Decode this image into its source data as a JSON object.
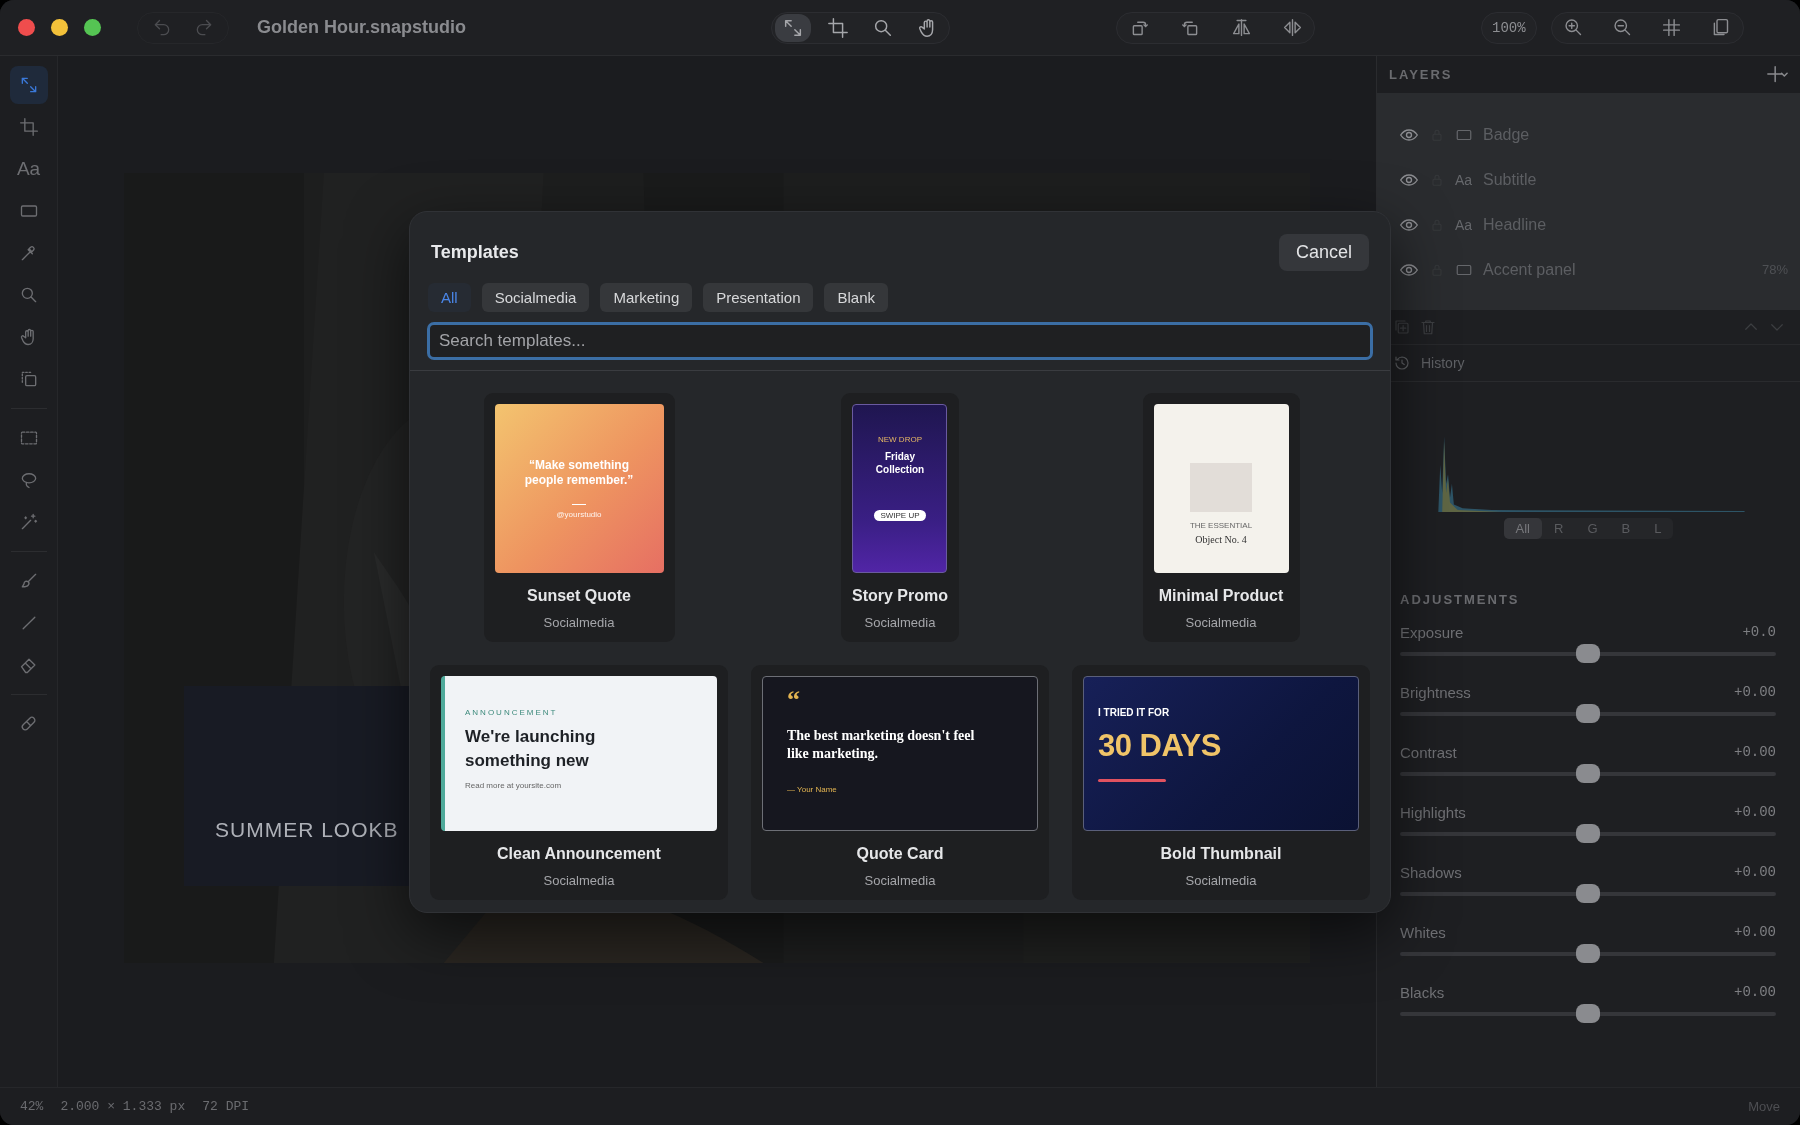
{
  "window": {
    "title": "Golden Hour.snapstudio"
  },
  "toolbar": {
    "center_tools": [
      {
        "selected": true
      },
      {
        "selected": false
      },
      {
        "selected": false
      },
      {
        "selected": false
      }
    ],
    "zoom": "100%"
  },
  "tools": {
    "groups": [
      [
        {
          "selected": true
        },
        {
          "selected": false
        },
        {
          "glyph": "Aa",
          "selected": false
        },
        {
          "selected": false
        },
        {
          "selected": false
        },
        {
          "selected": false
        },
        {
          "selected": false
        },
        {
          "selected": false
        }
      ],
      [
        {
          "selected": false
        },
        {
          "selected": false
        },
        {
          "selected": false
        }
      ],
      [
        {
          "selected": false
        },
        {
          "selected": false
        },
        {
          "selected": false
        }
      ],
      [
        {
          "selected": false
        }
      ]
    ]
  },
  "canvas": {
    "headline": "SUMMER LOOKB"
  },
  "layers": {
    "title": "LAYERS",
    "items": [
      {
        "name": "Badge",
        "kind": "shape"
      },
      {
        "name": "Subtitle",
        "kind": "text",
        "glyph": "Aa"
      },
      {
        "name": "Headline",
        "kind": "text",
        "glyph": "Aa"
      },
      {
        "name": "Accent panel",
        "kind": "shape",
        "opacity": "78%"
      }
    ]
  },
  "history": {
    "label": "History"
  },
  "histogram": {
    "channels": [
      {
        "label": "All",
        "selected": true
      },
      {
        "label": "R",
        "selected": false
      },
      {
        "label": "G",
        "selected": false
      },
      {
        "label": "B",
        "selected": false
      },
      {
        "label": "L",
        "selected": false
      }
    ]
  },
  "adjustments": {
    "title": "ADJUSTMENTS",
    "items": [
      {
        "name": "Exposure",
        "reading": "+0.0",
        "level": 0.5
      },
      {
        "name": "Brightness",
        "reading": "+0.00",
        "level": 0.5
      },
      {
        "name": "Contrast",
        "reading": "+0.00",
        "level": 0.5
      },
      {
        "name": "Highlights",
        "reading": "+0.00",
        "level": 0.5
      },
      {
        "name": "Shadows",
        "reading": "+0.00",
        "level": 0.5
      },
      {
        "name": "Whites",
        "reading": "+0.00",
        "level": 0.5
      },
      {
        "name": "Blacks",
        "reading": "+0.00",
        "level": 0.5
      }
    ]
  },
  "status_bar": {
    "zoom": "42%",
    "size": "2.000 × 1.333 px",
    "resolution": "72 DPI",
    "tool": "Move"
  },
  "dialog": {
    "title": "Templates",
    "cancel": "Cancel",
    "filters": [
      {
        "label": "All",
        "selected": true
      },
      {
        "label": "Socialmedia",
        "selected": false
      },
      {
        "label": "Marketing",
        "selected": false
      },
      {
        "label": "Presentation",
        "selected": false
      },
      {
        "label": "Blank",
        "selected": false
      }
    ],
    "search": {
      "placeholder": "Search templates..."
    },
    "templates": [
      {
        "name": "Sunset Quote",
        "category": "Socialmedia",
        "thumbnail": {
          "kind": "quote-square",
          "lines": [
            "“Make something people remember.”",
            "@yourstudio"
          ]
        }
      },
      {
        "name": "Story Promo",
        "category": "Socialmedia",
        "thumbnail": {
          "kind": "story",
          "lines": [
            "NEW DROP",
            "Friday Collection",
            "SWIPE UP"
          ]
        }
      },
      {
        "name": "Minimal Product",
        "category": "Socialmedia",
        "thumbnail": {
          "kind": "product",
          "lines": [
            "THE ESSENTIAL",
            "Object No. 4"
          ]
        }
      },
      {
        "name": "Clean Announcement",
        "category": "Socialmedia",
        "thumbnail": {
          "kind": "announcement",
          "lines": [
            "ANNOUNCEMENT",
            "We're launching something new",
            "Read more at yoursite.com"
          ]
        }
      },
      {
        "name": "Quote Card",
        "category": "Socialmedia",
        "thumbnail": {
          "kind": "quote-card",
          "lines": [
            "“",
            "The best marketing doesn't feel like marketing.",
            "— Your Name"
          ]
        }
      },
      {
        "name": "Bold Thumbnail",
        "category": "Socialmedia",
        "thumbnail": {
          "kind": "bold",
          "lines": [
            "I TRIED IT FOR",
            "30 DAYS"
          ]
        }
      }
    ]
  }
}
